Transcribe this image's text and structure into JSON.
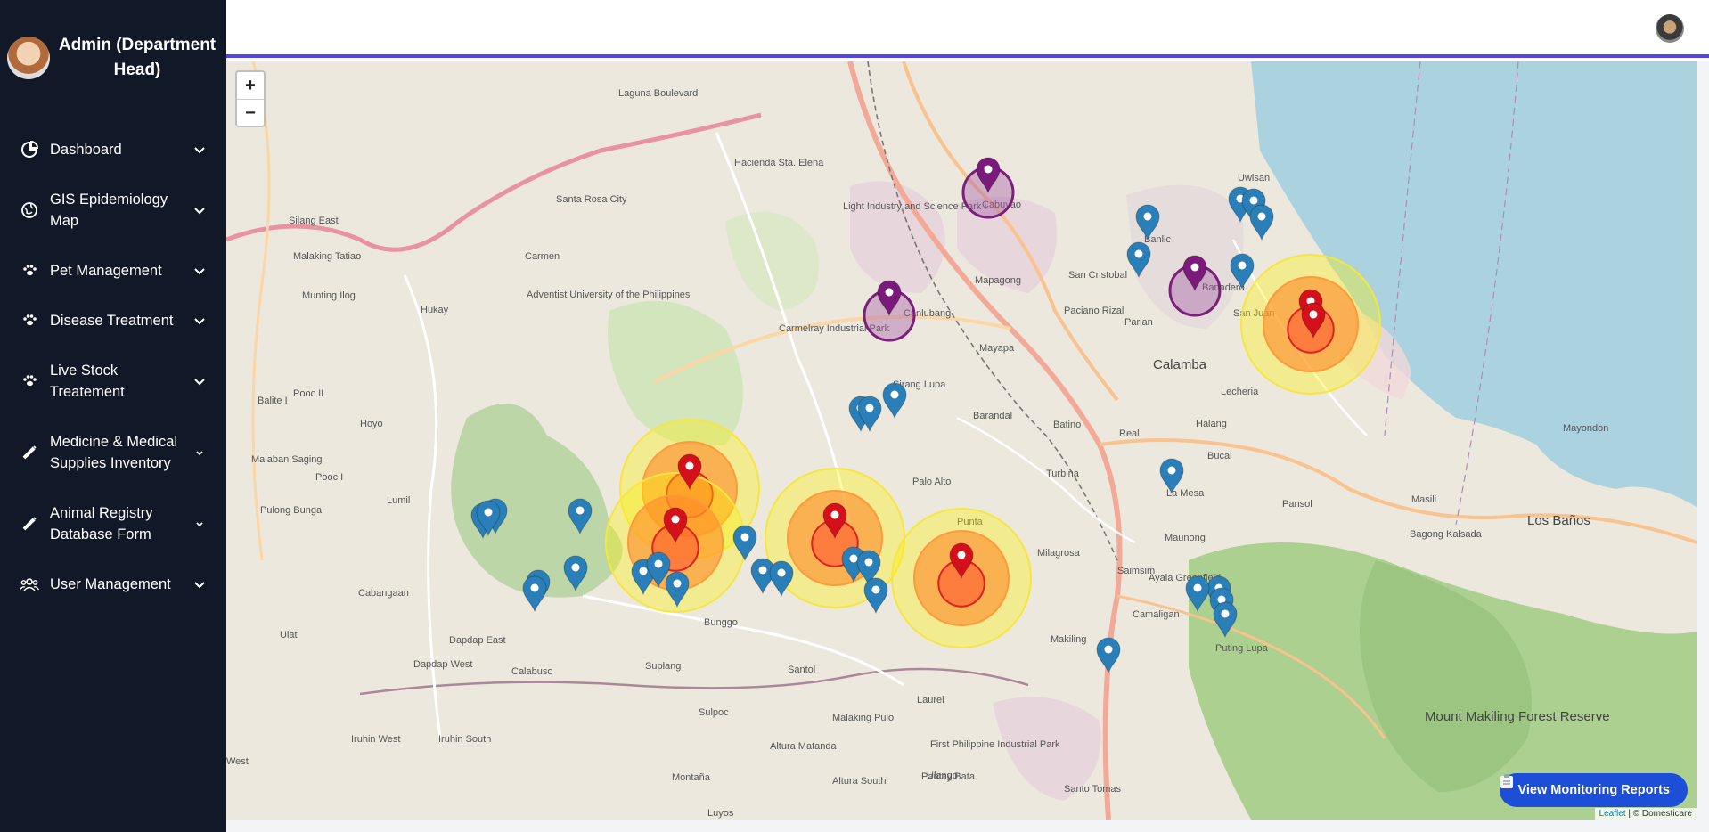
{
  "user": {
    "name": "Admin (Department Head)"
  },
  "nav": [
    {
      "label": "Dashboard",
      "icon": "pie-chart-icon"
    },
    {
      "label": "GIS Epidemiology Map",
      "icon": "globe-icon"
    },
    {
      "label": "Pet Management",
      "icon": "paw-icon"
    },
    {
      "label": "Disease Treatment",
      "icon": "paw-icon"
    },
    {
      "label": "Live Stock Treatement",
      "icon": "paw-icon"
    },
    {
      "label": "Medicine & Medical Supplies Inventory",
      "icon": "syringe-icon"
    },
    {
      "label": "Animal Registry Database Form",
      "icon": "syringe-icon"
    },
    {
      "label": "User Management",
      "icon": "users-icon"
    }
  ],
  "map": {
    "zoom_in": "+",
    "zoom_out": "−",
    "monitor_button": "View Monitoring Reports",
    "attribution_link": "Leaflet",
    "attribution_text": "| © Domesticare",
    "place_labels": [
      "Carmen",
      "Hukay",
      "Munting Ilog",
      "Malaking Tatiao",
      "Hoyo",
      "Pooc II",
      "Balite I",
      "Pooc I",
      "Malaban Saging",
      "Pulong Bunga",
      "Lumil",
      "Cabangaan",
      "Dapdap East",
      "Dapdap West",
      "Calabuso",
      "Ulat",
      "Iruhin West",
      "Iruhin South",
      "Suplang",
      "Santol",
      "Sulpoc",
      "Malaking Pulo",
      "Altura Matanda",
      "Altura South",
      "Montaña",
      "Luyos",
      "Ulango",
      "Pantay Bata",
      "Laurel",
      "Makiling",
      "Camaligan",
      "Puting Lupa",
      "Maunong",
      "Saimsim",
      "Milagrosa",
      "Punta",
      "Turbina",
      "Palo Alto",
      "Barandal",
      "Batino",
      "Real",
      "Halang",
      "Bucal",
      "Pansol",
      "Masili",
      "Bagong Kalsada",
      "Los Baños",
      "Mapagong",
      "San Cristobal",
      "Banlic",
      "Paciano Rizal",
      "Parian",
      "Calamba",
      "Lecheria",
      "Mayapa",
      "Sirang Lupa",
      "Canlubang",
      "Cabuyao",
      "Banadero",
      "San Juan",
      "Santo Tomas",
      "West",
      "Bunggo",
      "La Mesa",
      "Uwisan",
      "Mount Makiling Forest Reserve",
      "Mayondon",
      "Ayala Greenfield",
      "Hacienda Sta. Elena",
      "Carmelray Industrial Park",
      "Light Industry and Science Park I",
      "First Philippine Industrial Park",
      "Laguna Boulevard",
      "Santa Rosa City",
      "Silang East",
      "Adventist University of the Philippines"
    ]
  }
}
